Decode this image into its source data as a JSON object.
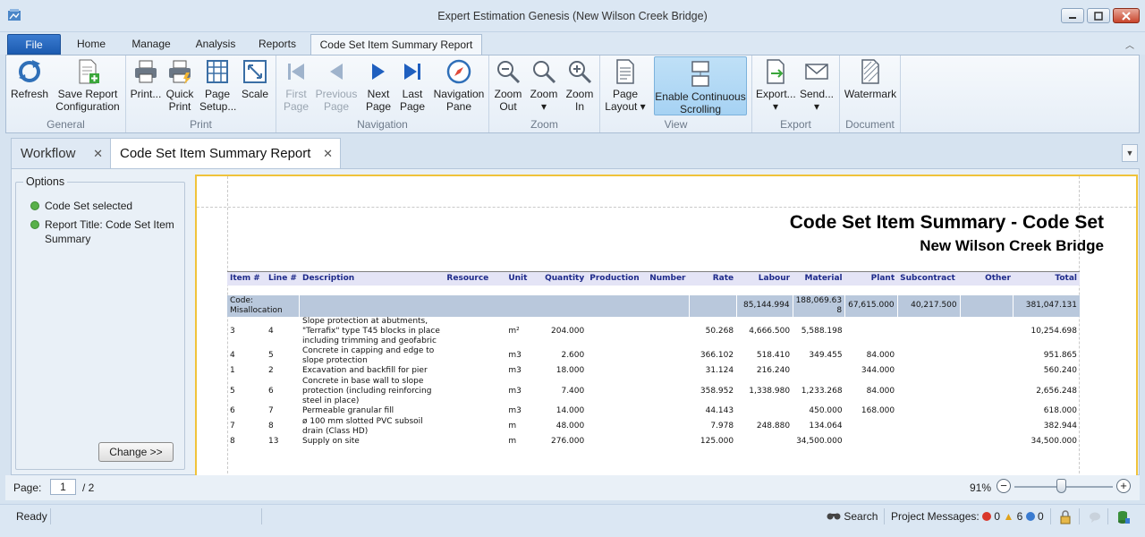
{
  "window": {
    "title": "Expert Estimation Genesis (New Wilson Creek Bridge)"
  },
  "ribbon_tabs": [
    "File",
    "Home",
    "Manage",
    "Analysis",
    "Reports",
    "Code Set Item Summary Report"
  ],
  "ribbon": {
    "groups": {
      "general": "General",
      "print": "Print",
      "navigation": "Navigation",
      "zoom": "Zoom",
      "view": "View",
      "export": "Export",
      "document": "Document"
    },
    "buttons": {
      "refresh": [
        "Refresh",
        ""
      ],
      "save_config": [
        "Save Report",
        "Configuration"
      ],
      "print": [
        "Print...",
        ""
      ],
      "quick_print": [
        "Quick",
        "Print"
      ],
      "page_setup": [
        "Page",
        "Setup..."
      ],
      "scale": [
        "Scale",
        ""
      ],
      "first_page": [
        "First",
        "Page"
      ],
      "previous_page": [
        "Previous",
        "Page"
      ],
      "next_page": [
        "Next",
        "Page"
      ],
      "last_page": [
        "Last",
        "Page"
      ],
      "navigation_pane": [
        "Navigation",
        "Pane"
      ],
      "zoom_out": [
        "Zoom",
        "Out"
      ],
      "zoom": [
        "Zoom",
        "▾"
      ],
      "zoom_in": [
        "Zoom",
        "In"
      ],
      "page_layout": [
        "Page",
        "Layout ▾"
      ],
      "continuous_scrolling": [
        "Enable Continuous",
        "Scrolling"
      ],
      "export": [
        "Export...",
        "▾"
      ],
      "send": [
        "Send...",
        "▾"
      ],
      "watermark": [
        "Watermark",
        ""
      ]
    }
  },
  "doc_tabs": {
    "workflow": "Workflow",
    "report": "Code Set Item Summary Report",
    "close_glyph": "✕"
  },
  "options": {
    "legend": "Options",
    "items": [
      "Code Set selected",
      "Report Title: Code Set Item Summary"
    ],
    "change_button": "Change >>"
  },
  "report": {
    "title": "Code Set Item Summary - Code Set",
    "subtitle": "New Wilson Creek Bridge",
    "columns": [
      "Item #",
      "Line #",
      "Description",
      "Resource",
      "Unit",
      "Quantity",
      "Production",
      "Number",
      "Rate",
      "Labour",
      "Material",
      "Plant",
      "Subcontract",
      "Other",
      "Total"
    ],
    "group": {
      "label": "Code: Misallocation",
      "labour": "85,144.994",
      "material": "188,069.63 8",
      "plant": "67,615.000",
      "subcontract": "40,217.500",
      "total": "381,047.131"
    },
    "rows": [
      {
        "item": "3",
        "line": "4",
        "description": "Slope protection at abutments, \"Terrafix\" type T45 blocks in place including trimming and geofabric",
        "resource": "",
        "unit": "m²",
        "quantity": "204.000",
        "production": "",
        "number": "",
        "rate": "50.268",
        "labour": "4,666.500",
        "material": "5,588.198",
        "plant": "",
        "subcontract": "",
        "other": "",
        "total": "10,254.698"
      },
      {
        "item": "4",
        "line": "5",
        "description": "Concrete in capping and edge to slope protection",
        "resource": "",
        "unit": "m3",
        "quantity": "2.600",
        "production": "",
        "number": "",
        "rate": "366.102",
        "labour": "518.410",
        "material": "349.455",
        "plant": "84.000",
        "subcontract": "",
        "other": "",
        "total": "951.865"
      },
      {
        "item": "1",
        "line": "2",
        "description": "Excavation and backfill for pier",
        "resource": "",
        "unit": "m3",
        "quantity": "18.000",
        "production": "",
        "number": "",
        "rate": "31.124",
        "labour": "216.240",
        "material": "",
        "plant": "344.000",
        "subcontract": "",
        "other": "",
        "total": "560.240"
      },
      {
        "item": "5",
        "line": "6",
        "description": "Concrete in base wall to slope protection (including reinforcing steel in place)",
        "resource": "",
        "unit": "m3",
        "quantity": "7.400",
        "production": "",
        "number": "",
        "rate": "358.952",
        "labour": "1,338.980",
        "material": "1,233.268",
        "plant": "84.000",
        "subcontract": "",
        "other": "",
        "total": "2,656.248"
      },
      {
        "item": "6",
        "line": "7",
        "description": "Permeable granular fill",
        "resource": "",
        "unit": "m3",
        "quantity": "14.000",
        "production": "",
        "number": "",
        "rate": "44.143",
        "labour": "",
        "material": "450.000",
        "plant": "168.000",
        "subcontract": "",
        "other": "",
        "total": "618.000"
      },
      {
        "item": "7",
        "line": "8",
        "description": "ø 100 mm slotted PVC subsoil drain (Class HD)",
        "resource": "",
        "unit": "m",
        "quantity": "48.000",
        "production": "",
        "number": "",
        "rate": "7.978",
        "labour": "248.880",
        "material": "134.064",
        "plant": "",
        "subcontract": "",
        "other": "",
        "total": "382.944"
      },
      {
        "item": "8",
        "line": "13",
        "description": "Supply on site",
        "resource": "",
        "unit": "m",
        "quantity": "276.000",
        "production": "",
        "number": "",
        "rate": "125.000",
        "labour": "",
        "material": "34,500.000",
        "plant": "",
        "subcontract": "",
        "other": "",
        "total": "34,500.000"
      }
    ]
  },
  "pagebar": {
    "label": "Page:",
    "current": "1",
    "total": "/ 2",
    "zoom": "91%",
    "zoom_level_fraction": 0.48
  },
  "statusbar": {
    "ready": "Ready",
    "search": "Search",
    "messages_label": "Project Messages:",
    "errors": "0",
    "warnings": "6",
    "info": "0"
  },
  "colors": {
    "accent": "#1c5bb0",
    "preview_border": "#f0c33a",
    "table_header": "#e4e4f6",
    "group_row": "#b9c8dc"
  }
}
